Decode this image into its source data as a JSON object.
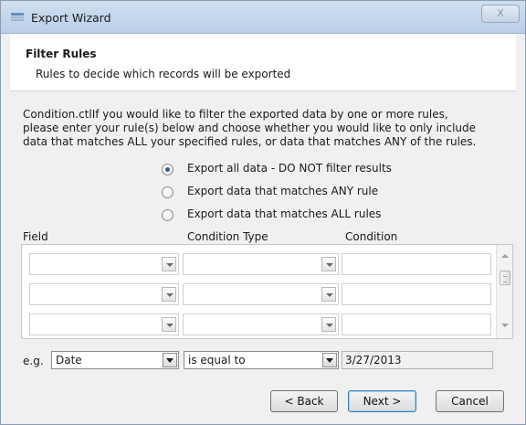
{
  "window": {
    "title": "Export Wizard",
    "close_label": "X"
  },
  "header": {
    "title": "Filter Rules",
    "subtitle": "Rules to decide which records will be exported"
  },
  "description": {
    "line1": "Condition.ctlIf you would like to filter the exported data by one or more rules,",
    "line2": "please enter your rule(s) below and choose whether you would like to only include",
    "line3": "data that matches ALL your specified rules, or data that matches ANY of the rules."
  },
  "options": [
    {
      "label": "Export all data - DO NOT filter results",
      "checked": true
    },
    {
      "label": "Export data that matches ANY rule",
      "checked": false
    },
    {
      "label": "Export data that matches ALL rules",
      "checked": false
    }
  ],
  "grid": {
    "columns": {
      "field": "Field",
      "condition_type": "Condition Type",
      "condition": "Condition"
    },
    "rows": [
      {
        "field": "",
        "condition_type": "",
        "condition": ""
      },
      {
        "field": "",
        "condition_type": "",
        "condition": ""
      },
      {
        "field": "",
        "condition_type": "",
        "condition": ""
      }
    ]
  },
  "example": {
    "label": "e.g.",
    "field": "Date",
    "condition_type": "is equal to",
    "condition": "3/27/2013"
  },
  "buttons": {
    "back": "< Back",
    "next": "Next >",
    "cancel": "Cancel"
  },
  "colors": {
    "accent": "#2a5d9e",
    "titlebar": "#c4d6eb"
  },
  "icons": {
    "app": "wizard-app-icon",
    "radio": "radio-dot"
  }
}
